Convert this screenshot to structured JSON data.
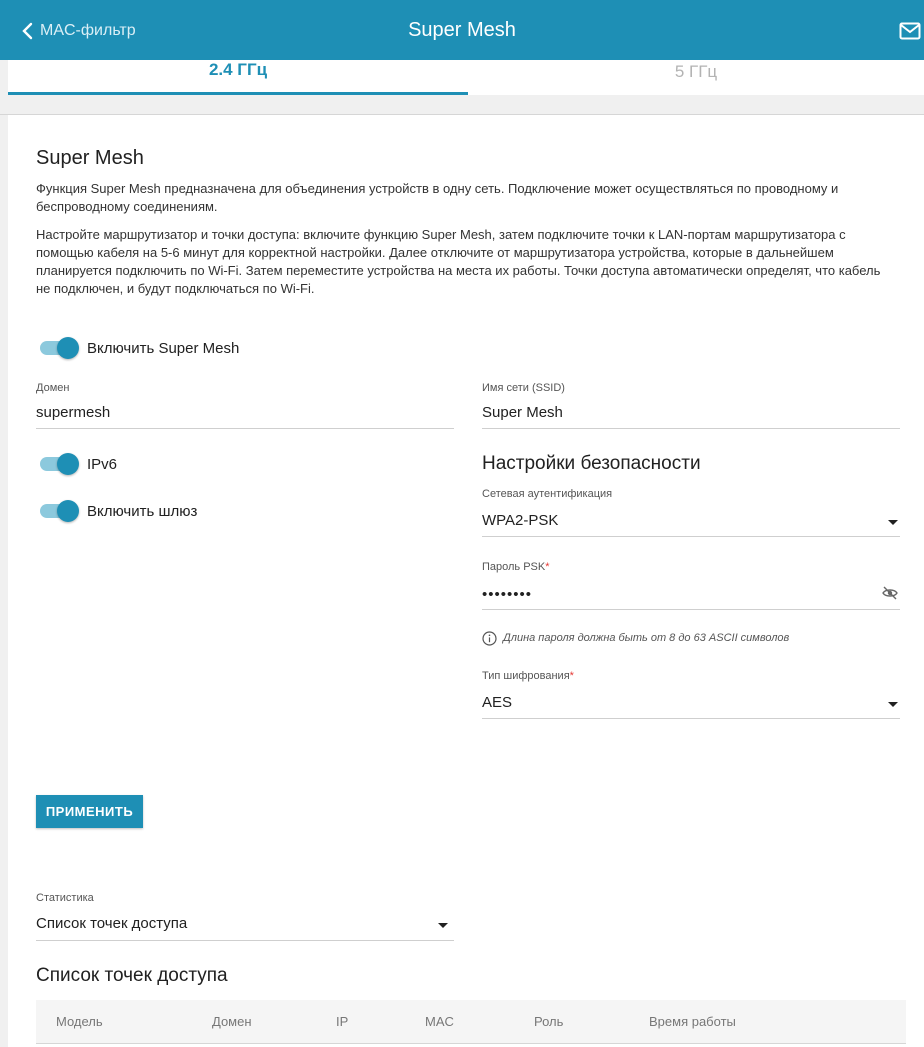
{
  "header": {
    "back_label": "MAC-фильтр",
    "title": "Super Mesh"
  },
  "tabs": [
    {
      "label": "2.4 ГГц",
      "active": true
    },
    {
      "label": "5 ГГц",
      "active": false
    }
  ],
  "section": {
    "title": "Super Mesh",
    "desc1": "Функция Super Mesh предназначена для объединения устройств в одну сеть. Подключение может осуществляться по проводному и беспроводному соединениям.",
    "desc2": "Настройте маршрутизатор и точки доступа: включите функцию Super Mesh, затем подключите точки к LAN-портам маршрутизатора с помощью кабеля на 5-6 минут для корректной настройки. Далее отключите от маршрутизатора устройства, которые в дальнейшем планируется подключить по Wi-Fi. Затем переместите устройства на места их работы. Точки доступа автоматически определят, что кабель не подключен, и будут подключаться по Wi-Fi."
  },
  "toggles": {
    "enable_mesh": {
      "label": "Включить Super Mesh",
      "on": true
    },
    "ipv6": {
      "label": "IPv6",
      "on": true
    },
    "gateway": {
      "label": "Включить шлюз",
      "on": true
    }
  },
  "fields": {
    "domain": {
      "label": "Домен",
      "value": "supermesh"
    },
    "ssid": {
      "label": "Имя сети (SSID)",
      "value": "Super Mesh"
    },
    "auth": {
      "label": "Сетевая аутентификация",
      "value": "WPA2-PSK"
    },
    "psk": {
      "label": "Пароль PSK",
      "required_mark": "*",
      "value": "••••••••"
    },
    "cipher": {
      "label": "Тип шифрования",
      "required_mark": "*",
      "value": "AES"
    },
    "stats": {
      "label": "Статистика",
      "value": "Список точек доступа"
    }
  },
  "security": {
    "title": "Настройки безопасности",
    "hint": "Длина пароля должна быть от 8 до 63 ASCII символов"
  },
  "apply_label": "ПРИМЕНИТЬ",
  "ap_list": {
    "title": "Список точек доступа",
    "columns": [
      "Модель",
      "Домен",
      "IP",
      "MAC",
      "Роль",
      "Время работы"
    ]
  },
  "icons": {
    "back": "chevron-left-icon",
    "mail": "mail-icon",
    "eye": "eye-off-icon",
    "info": "info-icon",
    "dropdown": "caret-down-icon"
  },
  "colors": {
    "accent": "#1e8fb5",
    "toggle_track": "#8cc9dd",
    "required": "#e53935"
  }
}
